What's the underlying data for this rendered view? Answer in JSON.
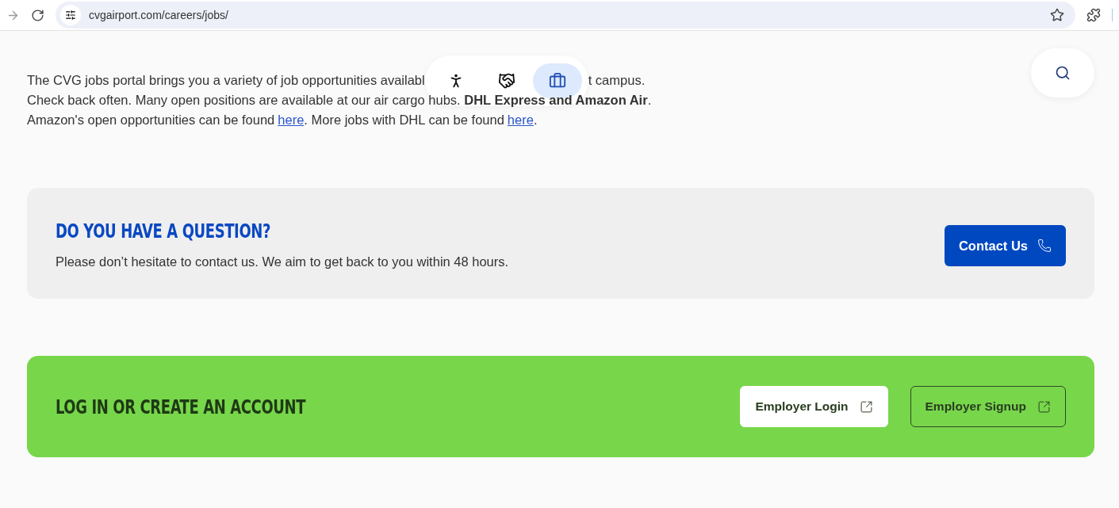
{
  "browser": {
    "url": "cvgairport.com/careers/jobs/"
  },
  "toolbar": {
    "items": [
      {
        "selected": false
      },
      {
        "selected": false
      },
      {
        "selected": true
      }
    ]
  },
  "intro": {
    "line_1_start": "The CVG jobs portal brings you a variety of job opportunities availabl",
    "line_1_end": "t campus.",
    "line_2": "Check back often. Many open positions are available at our air cargo hubs. **DHL Express and Amazon Air**.",
    "line_3_before": "Amazon's open opportunities can be found",
    "link_1": "here",
    "line_3_middle": ". More jobs with DHL can be found",
    "link_2": "here",
    "line_3_after": "."
  },
  "question": {
    "title": "DO YOU HAVE A QUESTION?",
    "text": "Please don’t hesitate to contact us. We aim to get back to you within 48 hours.",
    "button": "Contact Us"
  },
  "account": {
    "title": "LOG IN OR CREATE AN ACCOUNT",
    "buttons": [
      {
        "label": "Employer Login",
        "kind": "filled"
      },
      {
        "label": "Employer Signup",
        "kind": "outline"
      }
    ]
  }
}
